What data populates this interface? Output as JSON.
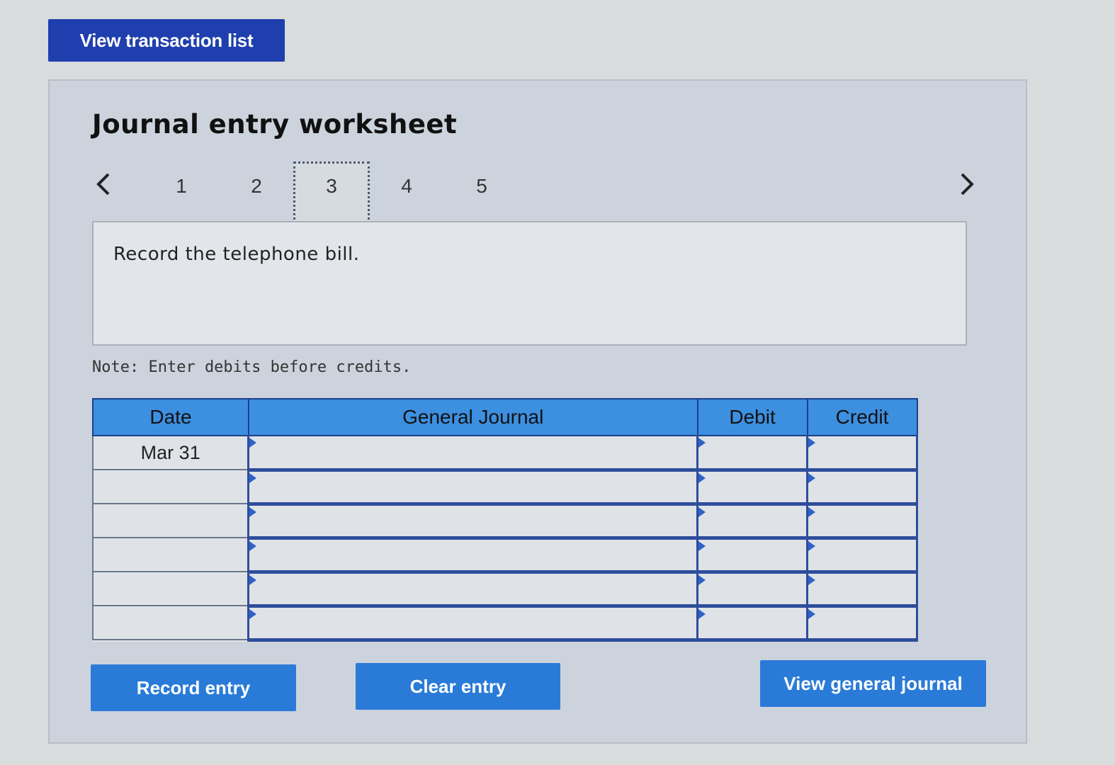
{
  "top": {
    "view_transaction_list": "View transaction list"
  },
  "worksheet": {
    "title": "Journal entry worksheet",
    "steps": [
      "1",
      "2",
      "3",
      "4",
      "5"
    ],
    "active_step": "3",
    "description": "Record the telephone bill.",
    "note": "Note: Enter debits before credits."
  },
  "table": {
    "headers": {
      "date": "Date",
      "account": "General Journal",
      "debit": "Debit",
      "credit": "Credit"
    },
    "rows": [
      {
        "date": "Mar 31",
        "account": "",
        "debit": "",
        "credit": ""
      },
      {
        "date": "",
        "account": "",
        "debit": "",
        "credit": ""
      },
      {
        "date": "",
        "account": "",
        "debit": "",
        "credit": ""
      },
      {
        "date": "",
        "account": "",
        "debit": "",
        "credit": ""
      },
      {
        "date": "",
        "account": "",
        "debit": "",
        "credit": ""
      },
      {
        "date": "",
        "account": "",
        "debit": "",
        "credit": ""
      }
    ]
  },
  "buttons": {
    "record": "Record entry",
    "clear": "Clear entry",
    "view_journal": "View general journal"
  },
  "icons": {
    "prev": "chevron-left-icon",
    "next": "chevron-right-icon"
  },
  "colors": {
    "primary": "#1f3fae",
    "header": "#3d8fe0",
    "button": "#2a7bd8"
  }
}
